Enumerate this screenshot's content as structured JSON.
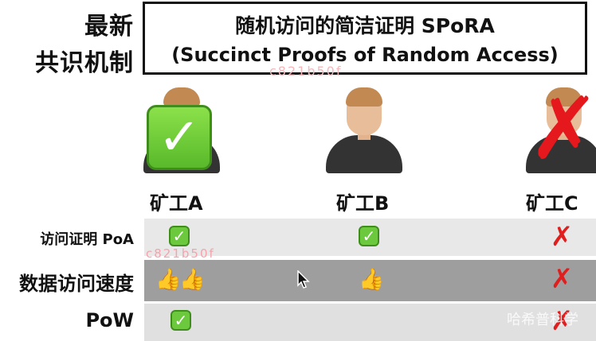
{
  "header": {
    "left_line1": "最新",
    "left_line2": "共识机制",
    "title_line1": "随机访问的简洁证明 SPoRA",
    "title_line2": "(Succinct Proofs of Random Access)",
    "watermark_top": "c821b50f"
  },
  "miners": [
    {
      "label": "矿工A",
      "status_icon": "big-check-icon"
    },
    {
      "label": "矿工B",
      "status_icon": "none"
    },
    {
      "label": "矿工C",
      "status_icon": "big-cross-icon"
    }
  ],
  "rows": [
    {
      "label": "访问证明 PoA",
      "cells": [
        "check-icon",
        "check-icon",
        "cross-icon"
      ]
    },
    {
      "label": "数据访问速度",
      "cells": [
        "two-thumbs-up-icon",
        "thumb-up-icon",
        "cross-icon"
      ]
    },
    {
      "label": "PoW",
      "cells": [
        "check-icon",
        "",
        "cross-icon"
      ]
    }
  ],
  "watermarks": {
    "table": "c821b50f",
    "bottom_right": "哈希普科学"
  },
  "icons": {
    "big_check": "✓",
    "big_cross": "✗",
    "check": "✓",
    "cross": "✗",
    "thumb": "👍"
  },
  "colors": {
    "check_green": "#6cc93e",
    "cross_red": "#e01e1e",
    "skin": "#e8bd99",
    "hair": "#c28a52",
    "shirt": "#333333"
  }
}
